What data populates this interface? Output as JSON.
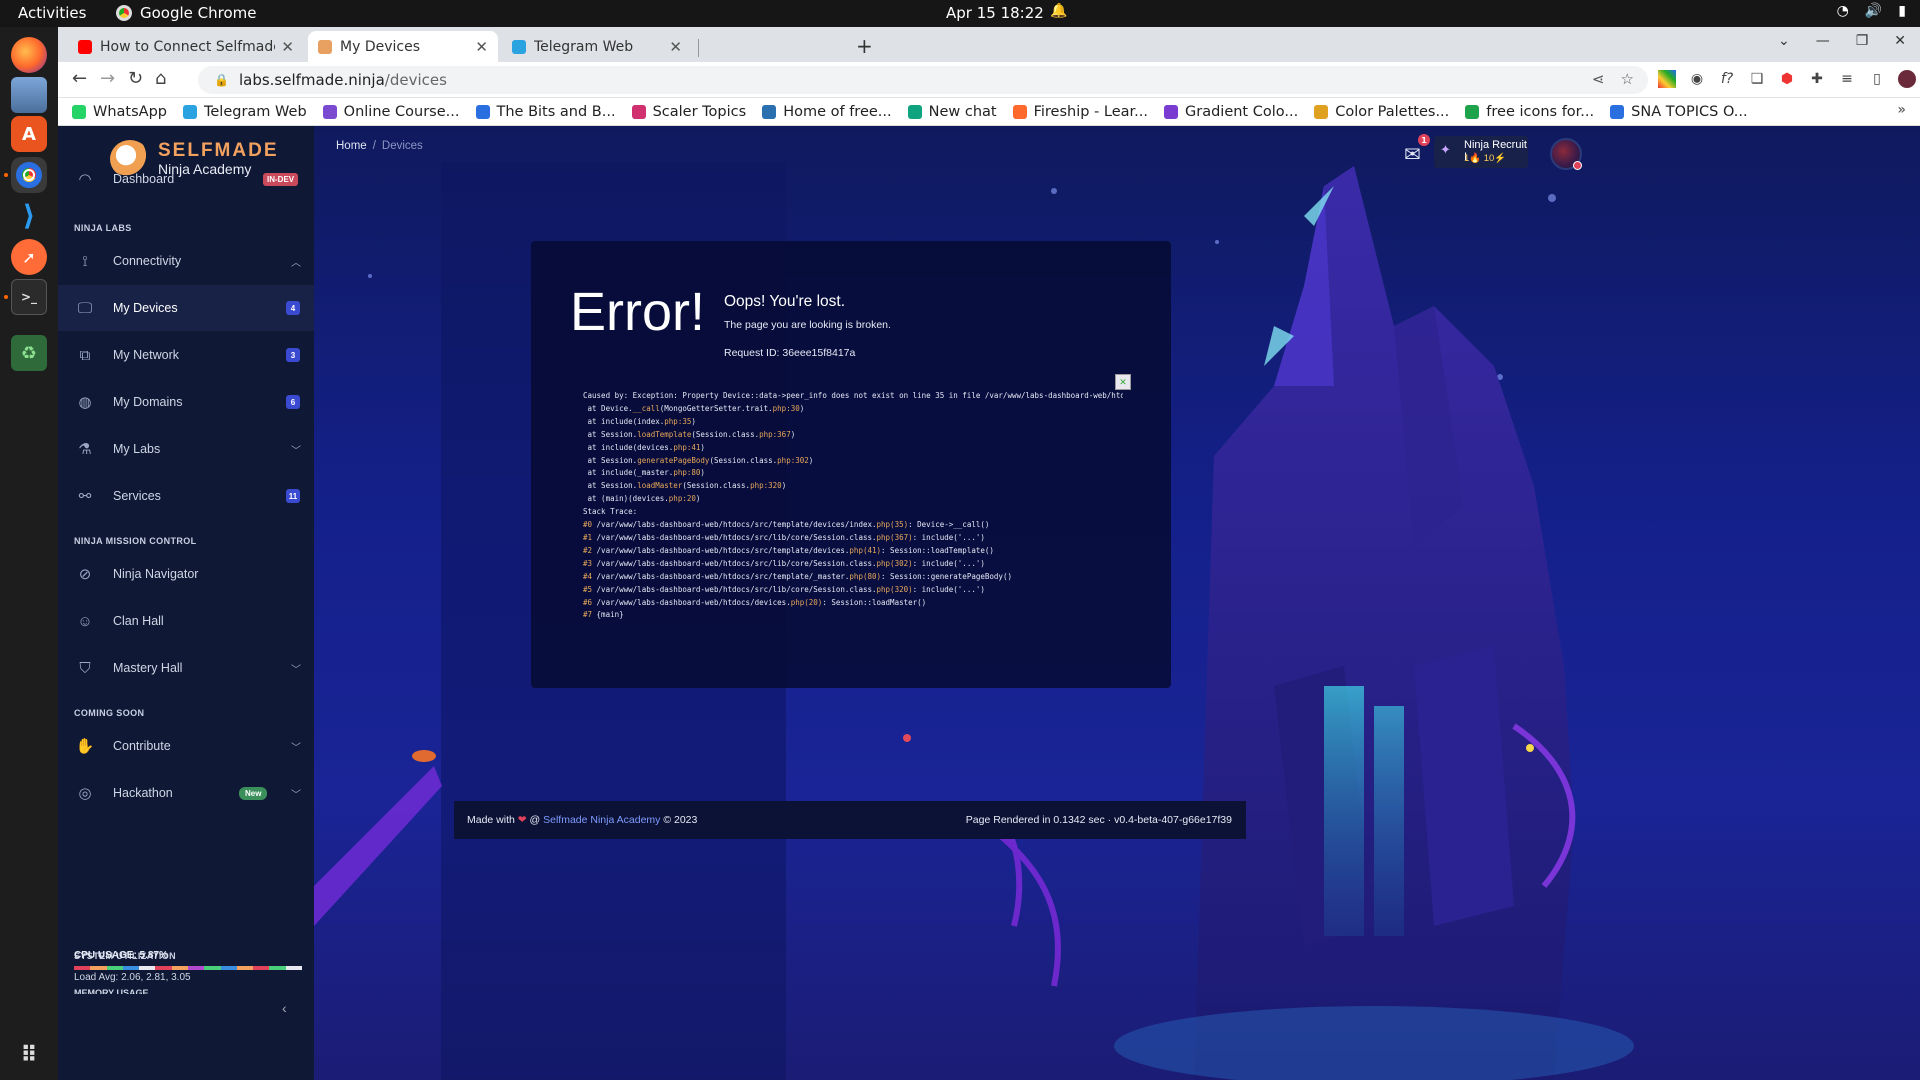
{
  "topbar": {
    "activities": "Activities",
    "app": "Google Chrome",
    "clock": "Apr 15  18:22"
  },
  "tabs": [
    {
      "title": "How to Connect Selfmade",
      "favicon_color": "#ff0000"
    },
    {
      "title": "My Devices",
      "favicon_color": "#e8a060"
    },
    {
      "title": "Telegram Web",
      "favicon_color": "#2aa3e0"
    }
  ],
  "omnibox": {
    "host": "labs.selfmade.ninja",
    "path": "/devices"
  },
  "bookmarks": [
    {
      "label": "WhatsApp",
      "color": "#25d366"
    },
    {
      "label": "Telegram Web",
      "color": "#2aa3e0"
    },
    {
      "label": "Online Course...",
      "color": "#7a4bd1"
    },
    {
      "label": "The Bits and B...",
      "color": "#2a6fe0"
    },
    {
      "label": "Scaler Topics",
      "color": "#d0306e"
    },
    {
      "label": "Home of free...",
      "color": "#2a6fb0"
    },
    {
      "label": "New chat",
      "color": "#10a37f"
    },
    {
      "label": "Fireship - Lear...",
      "color": "#ff6a2c"
    },
    {
      "label": "Gradient Colo...",
      "color": "#7a3bd1"
    },
    {
      "label": "Color Palettes...",
      "color": "#e0a020"
    },
    {
      "label": "free icons for...",
      "color": "#1fa34a"
    },
    {
      "label": "SNA TOPICS O...",
      "color": "#2a6fe0"
    }
  ],
  "brand": {
    "line1": "SELFMADE",
    "line2": "Ninja Academy"
  },
  "sidebar": {
    "dashboard": {
      "label": "Dashboard",
      "badge": "IN-DEV"
    },
    "section_labs": "NINJA LABS",
    "labs_items": [
      {
        "label": "Connectivity",
        "icon": "route-icon"
      },
      {
        "label": "My Devices",
        "icon": "devices-icon",
        "count": "4"
      },
      {
        "label": "My Network",
        "icon": "network-icon",
        "count": "3"
      },
      {
        "label": "My Domains",
        "icon": "globe-icon",
        "count": "6"
      },
      {
        "label": "My Labs",
        "icon": "flask-icon"
      },
      {
        "label": "Services",
        "icon": "sitemap-icon",
        "count": "11"
      }
    ],
    "section_mission": "NINJA MISSION CONTROL",
    "mission_items": [
      {
        "label": "Ninja Navigator",
        "icon": "compass-icon"
      },
      {
        "label": "Clan Hall",
        "icon": "users-icon"
      },
      {
        "label": "Mastery Hall",
        "icon": "shield-icon"
      }
    ],
    "section_soon": "COMING SOON",
    "soon_items": [
      {
        "label": "Contribute",
        "icon": "handshake-icon"
      },
      {
        "label": "Hackathon",
        "icon": "fingerprint-icon",
        "badge": "New"
      }
    ],
    "section_system": "SYSTEM UTILIZATION",
    "cpu": "CPU USAGE: 5.87%",
    "cpu_fraction": 0.0587,
    "load": "Load Avg: 2.06, 2.81, 3.05",
    "memory": "MEMORY USAGE"
  },
  "header": {
    "breadcrumb_home": "Home",
    "breadcrumb_current": "Devices",
    "mail_count": "1",
    "rank_name": "Ninja Recruit I",
    "rank_points": "1🔥 10⚡"
  },
  "error": {
    "title": "Error!",
    "heading": "Oops! You're lost.",
    "subtext": "The page you are looking is broken.",
    "request_id": "Request ID: 36eee15f8417a",
    "caused_by": "Caused by: Exception: Property Device::data->peer_info does not exist on line 35 in file /var/www/labs-dashboard-web/htdocs/src",
    "at_lines": [
      {
        "pre": " at Device.",
        "hl": "__call",
        "post": "(MongoGetterSetter.trait.",
        "num": "php:30",
        "end": ")"
      },
      {
        "pre": " at include(index.",
        "hl": "",
        "post": "",
        "num": "php:35",
        "end": ")"
      },
      {
        "pre": " at Session.",
        "hl": "loadTemplate",
        "post": "(Session.class.",
        "num": "php:367",
        "end": ")"
      },
      {
        "pre": " at include(devices.",
        "hl": "",
        "post": "",
        "num": "php:41",
        "end": ")"
      },
      {
        "pre": " at Session.",
        "hl": "generatePageBody",
        "post": "(Session.class.",
        "num": "php:302",
        "end": ")"
      },
      {
        "pre": " at include(_master.",
        "hl": "",
        "post": "",
        "num": "php:80",
        "end": ")"
      },
      {
        "pre": " at Session.",
        "hl": "loadMaster",
        "post": "(Session.class.",
        "num": "php:320",
        "end": ")"
      },
      {
        "pre": " at (main)(devices.",
        "hl": "",
        "post": "",
        "num": "php:20",
        "end": ")"
      }
    ],
    "stack_label": "Stack Trace:",
    "stack_lines": [
      {
        "n": "#0",
        "path": " /var/www/labs-dashboard-web/htdocs/src/template/devices/index.",
        "num": "php(35)",
        "rest": ": Device->__call()"
      },
      {
        "n": "#1",
        "path": " /var/www/labs-dashboard-web/htdocs/src/lib/core/Session.class.",
        "num": "php(367)",
        "rest": ": include('...')"
      },
      {
        "n": "#2",
        "path": " /var/www/labs-dashboard-web/htdocs/src/template/devices.",
        "num": "php(41)",
        "rest": ": Session::loadTemplate()"
      },
      {
        "n": "#3",
        "path": " /var/www/labs-dashboard-web/htdocs/src/lib/core/Session.class.",
        "num": "php(302)",
        "rest": ": include('...')"
      },
      {
        "n": "#4",
        "path": " /var/www/labs-dashboard-web/htdocs/src/template/_master.",
        "num": "php(80)",
        "rest": ": Session::generatePageBody()"
      },
      {
        "n": "#5",
        "path": " /var/www/labs-dashboard-web/htdocs/src/lib/core/Session.class.",
        "num": "php(320)",
        "rest": ": include('...')"
      },
      {
        "n": "#6",
        "path": " /var/www/labs-dashboard-web/htdocs/devices.",
        "num": "php(20)",
        "rest": ": Session::loadMaster()"
      },
      {
        "n": "#7",
        "path": " {main}",
        "num": "",
        "rest": ""
      }
    ]
  },
  "footer": {
    "made_with": "Made with",
    "at": "@",
    "link": "Selfmade Ninja Academy",
    "year": "© 2023",
    "rendered": "Page Rendered in 0.1342 sec · v0.4-beta-407-g66e17f39"
  },
  "colors": {
    "accent": "#3b4bd1",
    "brand_orange": "#f3a15f",
    "badge_red": "#c84a5b",
    "badge_green": "#3a8f5a",
    "link": "#7e9bff"
  }
}
